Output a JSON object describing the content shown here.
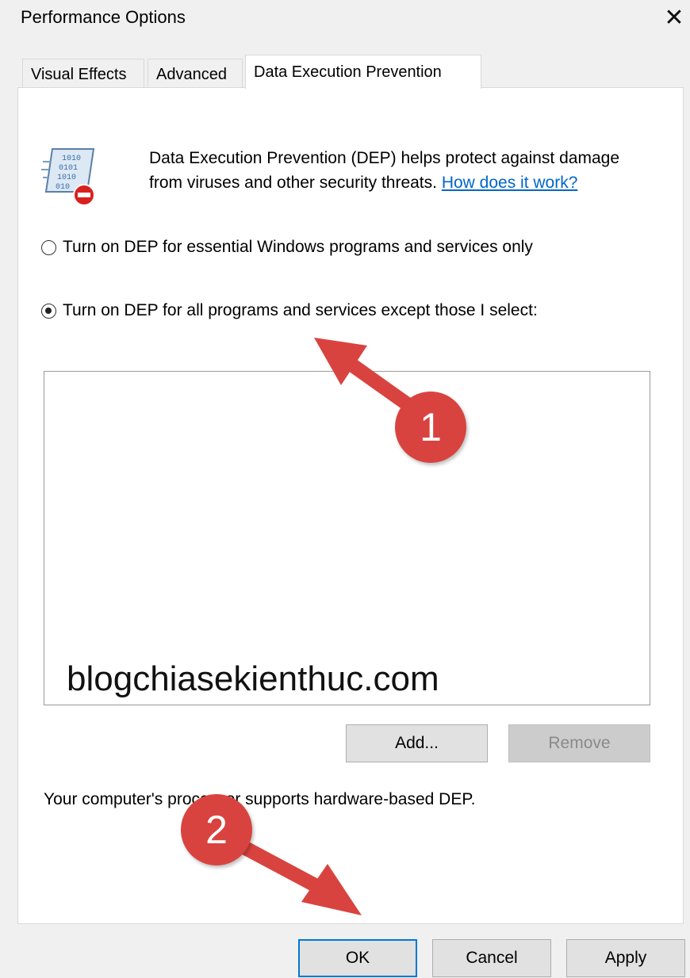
{
  "window": {
    "title": "Performance Options",
    "close_glyph": "✕"
  },
  "tabs": [
    {
      "label": "Visual Effects",
      "active": false
    },
    {
      "label": "Advanced",
      "active": false
    },
    {
      "label": "Data Execution Prevention",
      "active": true
    }
  ],
  "dep": {
    "icon": "dep-shield-icon",
    "description": "Data Execution Prevention (DEP) helps protect against damage from viruses and other security threats.",
    "link_text": "How does it work?",
    "radio_essential": {
      "label": "Turn on DEP for essential Windows programs and services only",
      "checked": false
    },
    "radio_all": {
      "label": "Turn on DEP for all programs and services except those I select:",
      "checked": true
    },
    "watermark": "blogchiasekienthuc.com",
    "add_label": "Add...",
    "remove_label": "Remove",
    "status_text": "Your computer's processor supports hardware-based DEP."
  },
  "footer": {
    "ok_label": "OK",
    "cancel_label": "Cancel",
    "apply_label": "Apply"
  },
  "annotations": {
    "step1": "1",
    "step2": "2",
    "color": "#d9433f"
  }
}
